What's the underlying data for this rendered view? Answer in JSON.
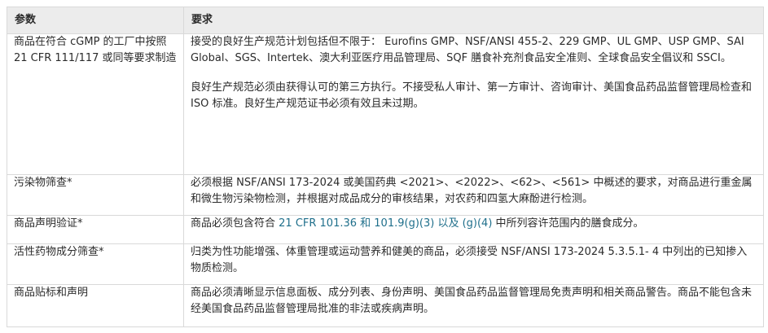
{
  "header": {
    "col1": "参数",
    "col2": "要求"
  },
  "rows": [
    {
      "param": "商品在符合 cGMP 的工厂中按照 21 CFR 111/117 或同等要求制造",
      "req_p1": "接受的良好生产规范计划包括但不限于：  Eurofins GMP、NSF/ANSI 455-2、229 GMP、UL GMP、USP GMP、SAI Global、SGS、Intertek、澳大利亚医疗用品管理局、SQF 膳食补充剂食品安全准则、全球食品安全倡议和 SSCI。",
      "req_p2": "良好生产规范必须由获得认可的第三方执行。不接受私人审计、第一方审计、咨询审计、美国食品药品监督管理局检查和 ISO 标准。良好生产规范证书必须有效且未过期。"
    },
    {
      "param": "污染物筛查*",
      "req": "必须根据 NSF/ANSI 173-2024 或美国药典 <2021>、<2022>、<62>、<561> 中概述的要求，对商品进行重金属和微生物污染物检测，并根据对成品成分的审核结果，对农药和四氢大麻酚进行检测。"
    },
    {
      "param": "商品声明验证*",
      "req_pre": "商品必须包含符合 ",
      "req_link": "21 CFR 101.36 和 101.9(g)(3) 以及 (g)(4)",
      "req_post": " 中所列容许范围内的膳食成分。"
    },
    {
      "param": "活性药物成分筛查*",
      "req": "归类为性功能增强、体重管理或运动营养和健美的商品，必须接受 NSF/ANSI 173-2024 5.3.5.1- 4 中列出的已知掺入物质检测。"
    },
    {
      "param": "商品贴标和声明",
      "req": "商品必须清晰显示信息面板、成分列表、身份声明、美国食品药品监督管理局免责声明和相关商品警告。商品不能包含未经美国食品药品监督管理局批准的非法或疾病声明。"
    }
  ]
}
